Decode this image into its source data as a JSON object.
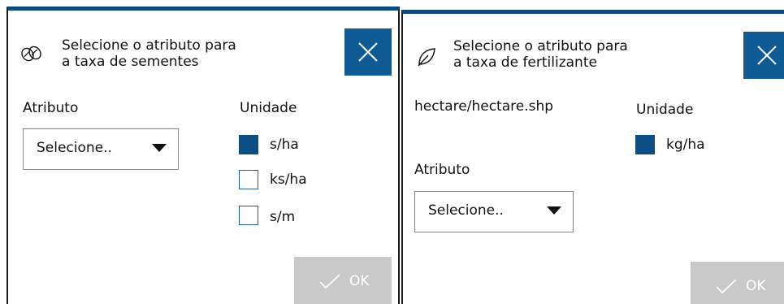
{
  "seed_dialog": {
    "title_line1": "Selecione o atributo para",
    "title_line2": "a taxa de sementes",
    "icon": "seed-icon",
    "attribute_label": "Atributo",
    "unit_label": "Unidade",
    "select_value": "Selecione..",
    "units": [
      {
        "label": "s/ha",
        "checked": true
      },
      {
        "label": "ks/ha",
        "checked": false
      },
      {
        "label": "s/m",
        "checked": false
      }
    ],
    "ok_label": "OK"
  },
  "fert_dialog": {
    "title_line1": "Selecione o atributo para",
    "title_line2": "a taxa de fertilizante",
    "icon": "leaf-icon",
    "file_name": "hectare/hectare.shp",
    "attribute_label": "Atributo",
    "unit_label": "Unidade",
    "select_value": "Selecione..",
    "units": [
      {
        "label": "kg/ha",
        "checked": true
      }
    ],
    "ok_label": "OK"
  },
  "colors": {
    "accent": "#0e5a94",
    "header_bar": "#0c4a7d",
    "ok_disabled": "#c9c9c9"
  }
}
